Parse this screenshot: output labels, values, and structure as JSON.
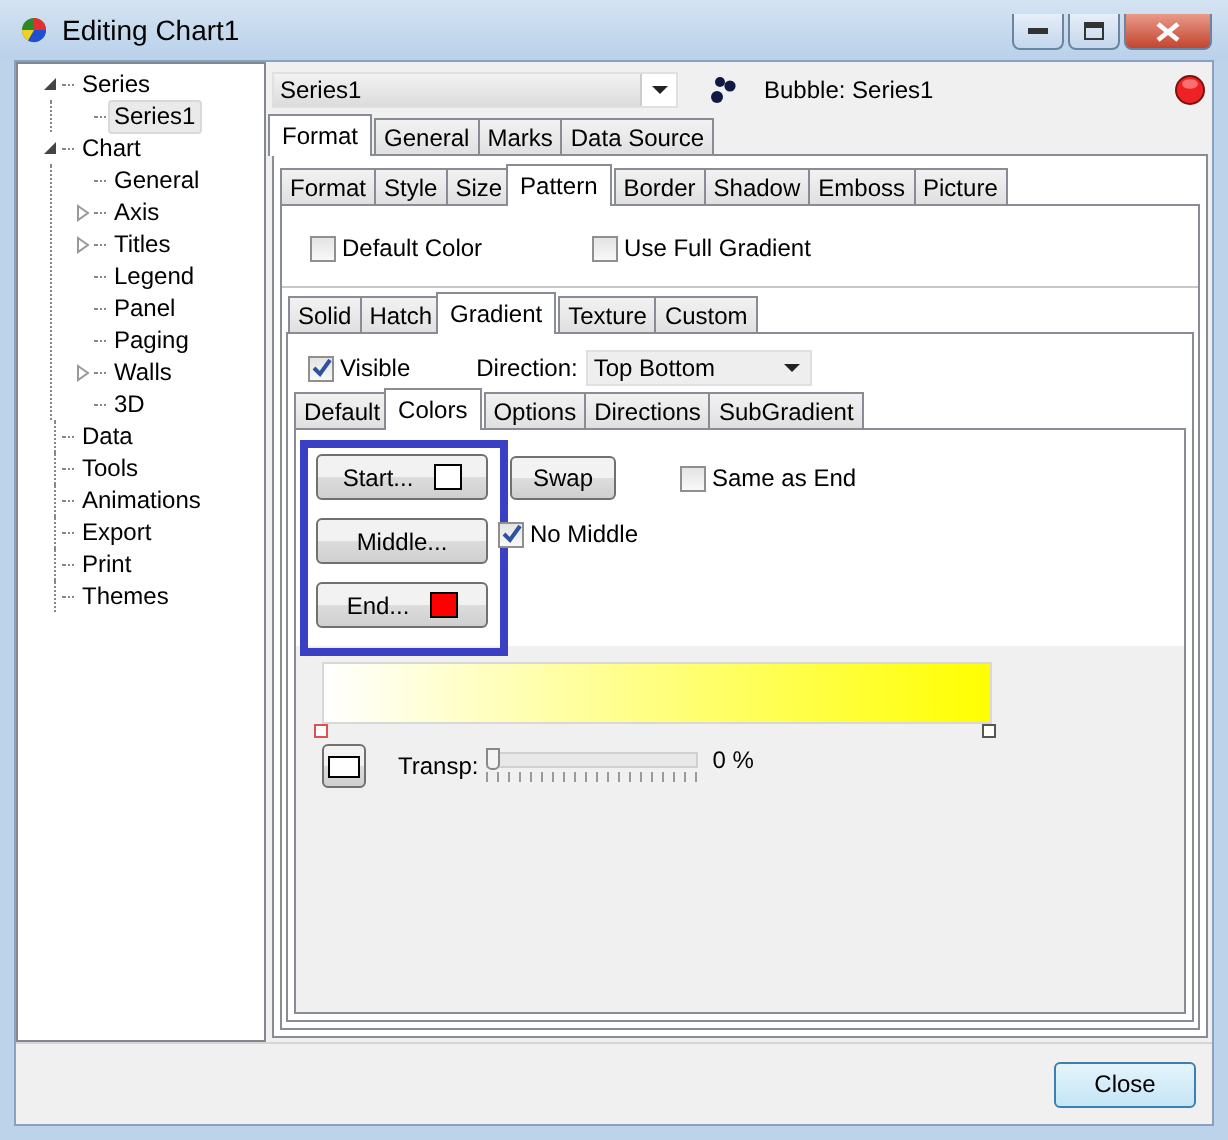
{
  "window": {
    "title": "Editing Chart1"
  },
  "tree": [
    {
      "label": "Series",
      "expanded": true,
      "selected": false,
      "children": [
        {
          "label": "Series1",
          "selected": true
        }
      ]
    },
    {
      "label": "Chart",
      "expanded": true,
      "selected": false,
      "children": [
        {
          "label": "General",
          "selected": false
        },
        {
          "label": "Axis",
          "expanded": false,
          "selected": false
        },
        {
          "label": "Titles",
          "expanded": false,
          "selected": false
        },
        {
          "label": "Legend",
          "selected": false
        },
        {
          "label": "Panel",
          "selected": false
        },
        {
          "label": "Paging",
          "selected": false
        },
        {
          "label": "Walls",
          "expanded": false,
          "selected": false
        },
        {
          "label": "3D",
          "selected": false
        }
      ]
    },
    {
      "label": "Data",
      "selected": false
    },
    {
      "label": "Tools",
      "selected": false
    },
    {
      "label": "Animations",
      "selected": false
    },
    {
      "label": "Export",
      "selected": false
    },
    {
      "label": "Print",
      "selected": false
    },
    {
      "label": "Themes",
      "selected": false
    }
  ],
  "series_select": {
    "value": "Series1"
  },
  "series_info": {
    "label": "Bubble: Series1"
  },
  "series_tabs": [
    {
      "label": "Format",
      "selected": true
    },
    {
      "label": "General",
      "selected": false
    },
    {
      "label": "Marks",
      "selected": false
    },
    {
      "label": "Data Source",
      "selected": false
    }
  ],
  "format_tabs": [
    {
      "label": "Format",
      "selected": false
    },
    {
      "label": "Style",
      "selected": false
    },
    {
      "label": "Size",
      "selected": false
    },
    {
      "label": "Pattern",
      "selected": true
    },
    {
      "label": "Border",
      "selected": false
    },
    {
      "label": "Shadow",
      "selected": false
    },
    {
      "label": "Emboss",
      "selected": false
    },
    {
      "label": "Picture",
      "selected": false
    }
  ],
  "pattern_options": [
    {
      "label": "Default Color",
      "checked": false
    },
    {
      "label": "Use Full Gradient",
      "checked": false
    }
  ],
  "fill_tabs": [
    {
      "label": "Solid",
      "selected": false
    },
    {
      "label": "Hatch",
      "selected": false
    },
    {
      "label": "Gradient",
      "selected": true
    },
    {
      "label": "Texture",
      "selected": false
    },
    {
      "label": "Custom",
      "selected": false
    }
  ],
  "gradient": {
    "visible": {
      "label": "Visible",
      "checked": true
    },
    "direction": {
      "label": "Direction:",
      "value": "Top Bottom"
    }
  },
  "gradient_tabs": [
    {
      "label": "Default",
      "selected": false
    },
    {
      "label": "Colors",
      "selected": true
    },
    {
      "label": "Options",
      "selected": false
    },
    {
      "label": "Directions",
      "selected": false
    },
    {
      "label": "SubGradient",
      "selected": false
    }
  ],
  "color_buttons": [
    {
      "label": "Start...",
      "color": "#ffffff"
    },
    {
      "label": "Middle..."
    },
    {
      "label": "End...",
      "color": "#ff0000"
    }
  ],
  "swap_button": {
    "label": "Swap"
  },
  "same_as_end": {
    "label": "Same as End",
    "checked": false
  },
  "no_middle": {
    "label": "No Middle",
    "checked": true
  },
  "preview": {
    "stops": [
      {
        "color": "#ffffff"
      },
      {
        "color": "#ffff00"
      }
    ]
  },
  "transparency": {
    "label": "Transp:",
    "level": 0,
    "reading": "0 %"
  },
  "buttons": [
    {
      "label": "Close"
    }
  ]
}
